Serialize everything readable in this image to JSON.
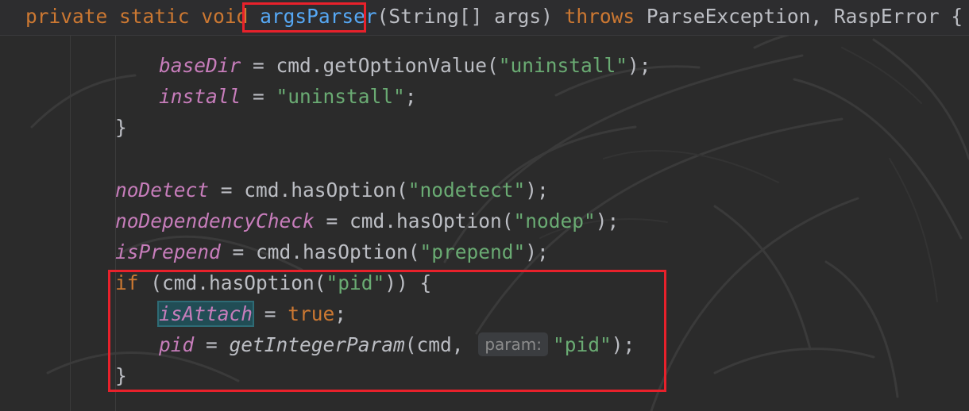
{
  "editor": {
    "signature": {
      "private_kw": "private",
      "static_kw": "static",
      "void_kw": "void",
      "method_name": "argsParser",
      "params": "(String[] args) ",
      "throws_kw": "throws",
      "exceptions": " ParseException, RaspError {"
    },
    "lines": {
      "basedir_field": "baseDir",
      "basedir_mid": " = cmd.getOptionValue(",
      "basedir_str": "\"uninstall\"",
      "basedir_end": ");",
      "install_field": "install",
      "install_mid": " = ",
      "install_str": "\"uninstall\"",
      "install_end": ";",
      "close_brace_1": "}",
      "nodetect_field": "noDetect",
      "nodetect_mid": " = cmd.hasOption(",
      "nodetect_str": "\"nodetect\"",
      "nodetect_end": ");",
      "nodep_field": "noDependencyCheck",
      "nodep_mid": " = cmd.hasOption(",
      "nodep_str": "\"nodep\"",
      "nodep_end": ");",
      "prepend_field": "isPrepend",
      "prepend_mid": " = cmd.hasOption(",
      "prepend_str": "\"prepend\"",
      "prepend_end": ");",
      "if_kw": "if",
      "if_mid": " (cmd.hasOption(",
      "if_str": "\"pid\"",
      "if_end": ")) {",
      "attach_field": "isAttach",
      "attach_mid": " = ",
      "attach_true": "true",
      "attach_end": ";",
      "pid_field": "pid",
      "pid_mid": " = ",
      "pid_method": "getIntegerParam",
      "pid_args": "(cmd, ",
      "pid_hint": "param:",
      "pid_str": "\"pid\"",
      "pid_end": ");",
      "close_brace_2": "}"
    }
  },
  "colors": {
    "background": "#2b2b2b",
    "keyword": "#cc7832",
    "method_declaration": "#56a8f5",
    "field": "#c77dbb",
    "string": "#6aab73",
    "annotation_box": "#e8212b"
  }
}
